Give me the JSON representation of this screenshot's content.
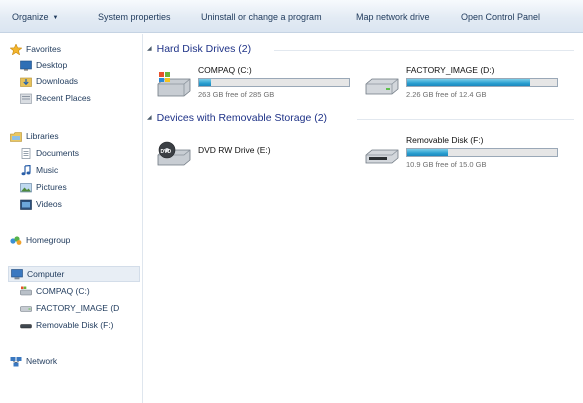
{
  "toolbar": {
    "organize": "Organize",
    "system_properties": "System properties",
    "uninstall": "Uninstall or change a program",
    "map_drive": "Map network drive",
    "control_panel": "Open Control Panel"
  },
  "nav": {
    "favorites": "Favorites",
    "desktop": "Desktop",
    "downloads": "Downloads",
    "recent_places": "Recent Places",
    "libraries": "Libraries",
    "documents": "Documents",
    "music": "Music",
    "pictures": "Pictures",
    "videos": "Videos",
    "homegroup": "Homegroup",
    "computer": "Computer",
    "compaq": "COMPAQ (C:)",
    "factory_image": "FACTORY_IMAGE (D",
    "removable": "Removable Disk (F:)",
    "network": "Network"
  },
  "groups": {
    "hdd": "Hard Disk Drives (2)",
    "removable": "Devices with Removable Storage (2)"
  },
  "drives": {
    "c": {
      "name": "COMPAQ (C:)",
      "free": "263 GB free of 285 GB",
      "used_fraction": 0.08
    },
    "d": {
      "name": "FACTORY_IMAGE (D:)",
      "free": "2.26 GB free of 12.4 GB",
      "used_fraction": 0.82
    },
    "e": {
      "name": "DVD RW Drive (E:)"
    },
    "f": {
      "name": "Removable Disk (F:)",
      "free": "10.9 GB free of 15.0 GB",
      "used_fraction": 0.27
    }
  },
  "colors": {
    "accent_text": "#1e3287",
    "bar_fill": "#2a9fd0",
    "toolbar_bg": "#e3ebf4"
  }
}
